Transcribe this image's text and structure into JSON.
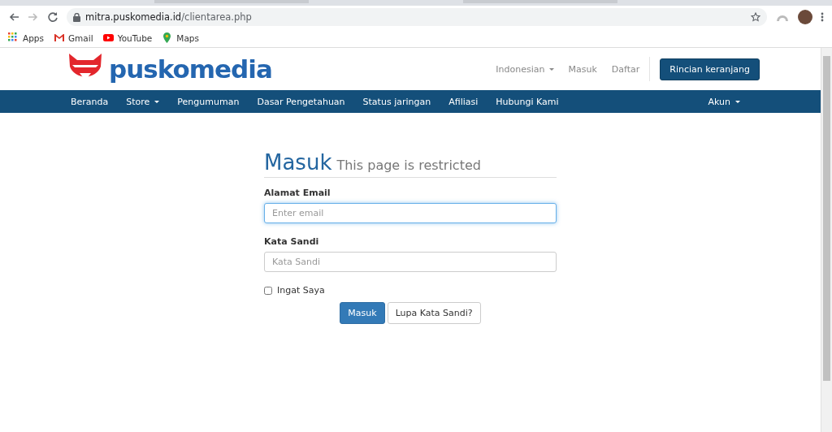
{
  "browser": {
    "url_host": "mitra.puskomedia.id",
    "url_path": "/clientarea.php",
    "bookmarked": false,
    "bookmarks": [
      {
        "label": "Apps",
        "kind": "apps"
      },
      {
        "label": "Gmail",
        "kind": "gmail"
      },
      {
        "label": "YouTube",
        "kind": "youtube"
      },
      {
        "label": "Maps",
        "kind": "maps"
      }
    ]
  },
  "header": {
    "logo": "puskomedia",
    "links": [
      {
        "label": "Indonesian",
        "dropdown": true
      },
      {
        "label": "Masuk",
        "dropdown": false
      },
      {
        "label": "Daftar",
        "dropdown": false
      }
    ],
    "cart_button": "Rincian keranjang"
  },
  "nav": {
    "items": [
      {
        "label": "Beranda",
        "dropdown": false
      },
      {
        "label": "Store",
        "dropdown": true
      },
      {
        "label": "Pengumuman",
        "dropdown": false
      },
      {
        "label": "Dasar Pengetahuan",
        "dropdown": false
      },
      {
        "label": "Status jaringan",
        "dropdown": false
      },
      {
        "label": "Afiliasi",
        "dropdown": false
      },
      {
        "label": "Hubungi Kami",
        "dropdown": false
      }
    ],
    "account": {
      "label": "Akun",
      "dropdown": true
    }
  },
  "login": {
    "title": "Masuk",
    "subtitle": "This page is restricted",
    "fields": [
      {
        "label": "Alamat Email",
        "placeholder": "Enter email",
        "focused": true
      },
      {
        "label": "Kata Sandi",
        "placeholder": "Kata Sandi",
        "focused": false
      }
    ],
    "remember": {
      "label": "Ingat Saya",
      "checked": false
    },
    "buttons": [
      {
        "label": "Masuk",
        "kind": "primary"
      },
      {
        "label": "Lupa Kata Sandi?",
        "kind": "default"
      }
    ]
  }
}
